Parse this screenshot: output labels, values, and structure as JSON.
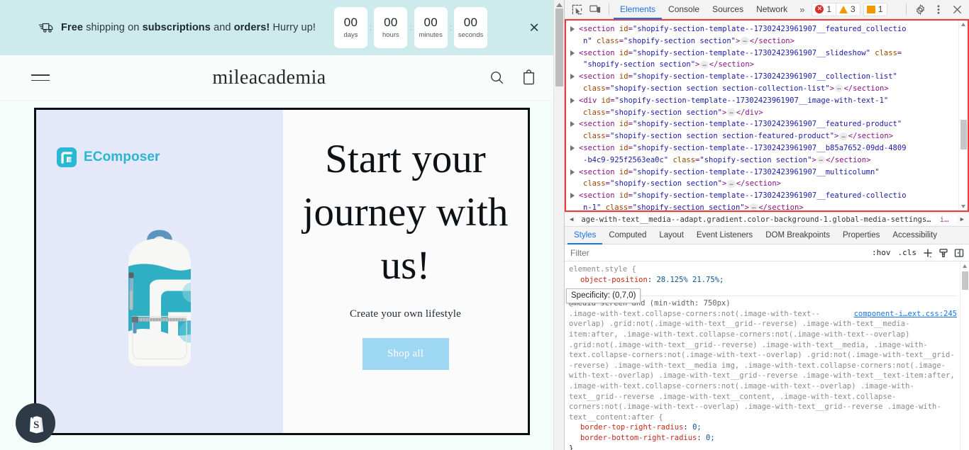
{
  "site": {
    "announcement": {
      "icon": "shipping-truck-icon",
      "text_parts": [
        {
          "t": "Free",
          "bold": true
        },
        {
          "t": " shipping on ",
          "bold": false
        },
        {
          "t": "subscriptions",
          "bold": true
        },
        {
          "t": " and ",
          "bold": false
        },
        {
          "t": "orders!",
          "bold": true
        },
        {
          "t": " Hurry up!",
          "bold": false
        }
      ],
      "full_text": "Free shipping on subscriptions and orders! Hurry up!",
      "close_label": "×",
      "countdown": [
        {
          "value": "00",
          "label": "days"
        },
        {
          "value": "00",
          "label": "hours"
        },
        {
          "value": "00",
          "label": "minutes"
        },
        {
          "value": "00",
          "label": "seconds"
        }
      ],
      "separator": ":",
      "bg_color": "#cdeaec"
    },
    "header": {
      "menu_icon": "hamburger-menu-icon",
      "brand": "mileacademia",
      "search_icon": "search-icon",
      "cart_icon": "cart-icon"
    },
    "hero": {
      "badge_text": "EComposer",
      "badge_color": "#29b6d1",
      "title": "Start your journey with us!",
      "subtitle": "Create your own lifestyle",
      "button_label": "Shop all",
      "button_color": "#9ed7f2",
      "media_highlight_color": "#e4e8f9",
      "product_alt": "teal and white backpack"
    },
    "shopify_bubble": "shopify-bag-icon"
  },
  "devtools": {
    "toolbar": {
      "inspect_icon": "inspect-element-icon",
      "device_icon": "device-toolbar-icon",
      "tabs": [
        {
          "label": "Elements",
          "active": true
        },
        {
          "label": "Console",
          "active": false
        },
        {
          "label": "Sources",
          "active": false
        },
        {
          "label": "Network",
          "active": false
        }
      ],
      "more_tabs": "»",
      "error_count": "1",
      "warning_count": "3",
      "issue_count": "1",
      "settings_icon": "gear-icon",
      "kebab_icon": "more-vertical-icon",
      "close_icon": "close-icon"
    },
    "dom_nodes": [
      {
        "lines": [
          [
            {
              "c": "punc",
              "t": "<"
            },
            {
              "c": "tag",
              "t": "section"
            },
            {
              "c": "sp",
              "t": " "
            },
            {
              "c": "attr",
              "t": "id"
            },
            {
              "c": "punc",
              "t": "="
            },
            {
              "c": "val",
              "t": "\"shopify-section-template--17302423961907__featured_collectio"
            }
          ],
          [
            {
              "c": "val",
              "t": "n\""
            },
            {
              "c": "sp",
              "t": " "
            },
            {
              "c": "attr",
              "t": "class"
            },
            {
              "c": "punc",
              "t": "="
            },
            {
              "c": "val",
              "t": "\"shopify-section section\""
            },
            {
              "c": "punc",
              "t": ">"
            },
            {
              "c": "dots",
              "t": "…"
            },
            {
              "c": "punc",
              "t": "</"
            },
            {
              "c": "tag",
              "t": "section"
            },
            {
              "c": "punc",
              "t": ">"
            }
          ]
        ]
      },
      {
        "lines": [
          [
            {
              "c": "punc",
              "t": "<"
            },
            {
              "c": "tag",
              "t": "section"
            },
            {
              "c": "sp",
              "t": " "
            },
            {
              "c": "attr",
              "t": "id"
            },
            {
              "c": "punc",
              "t": "="
            },
            {
              "c": "val",
              "t": "\"shopify-section-template--17302423961907__slideshow\""
            },
            {
              "c": "sp",
              "t": " "
            },
            {
              "c": "attr",
              "t": "class"
            },
            {
              "c": "punc",
              "t": "="
            }
          ],
          [
            {
              "c": "val",
              "t": "\"shopify-section section\""
            },
            {
              "c": "punc",
              "t": ">"
            },
            {
              "c": "dots",
              "t": "…"
            },
            {
              "c": "punc",
              "t": "</"
            },
            {
              "c": "tag",
              "t": "section"
            },
            {
              "c": "punc",
              "t": ">"
            }
          ]
        ]
      },
      {
        "lines": [
          [
            {
              "c": "punc",
              "t": "<"
            },
            {
              "c": "tag",
              "t": "section"
            },
            {
              "c": "sp",
              "t": " "
            },
            {
              "c": "attr",
              "t": "id"
            },
            {
              "c": "punc",
              "t": "="
            },
            {
              "c": "val",
              "t": "\"shopify-section-template--17302423961907__collection-list\""
            }
          ],
          [
            {
              "c": "attr",
              "t": "class"
            },
            {
              "c": "punc",
              "t": "="
            },
            {
              "c": "val",
              "t": "\"shopify-section section section-collection-list\""
            },
            {
              "c": "punc",
              "t": ">"
            },
            {
              "c": "dots",
              "t": "…"
            },
            {
              "c": "punc",
              "t": "</"
            },
            {
              "c": "tag",
              "t": "section"
            },
            {
              "c": "punc",
              "t": ">"
            }
          ]
        ]
      },
      {
        "lines": [
          [
            {
              "c": "punc",
              "t": "<"
            },
            {
              "c": "tag",
              "t": "div"
            },
            {
              "c": "sp",
              "t": " "
            },
            {
              "c": "attr",
              "t": "id"
            },
            {
              "c": "punc",
              "t": "="
            },
            {
              "c": "val",
              "t": "\"shopify-section-template--17302423961907__image-with-text-1\""
            }
          ],
          [
            {
              "c": "attr",
              "t": "class"
            },
            {
              "c": "punc",
              "t": "="
            },
            {
              "c": "val",
              "t": "\"shopify-section section\""
            },
            {
              "c": "punc",
              "t": ">"
            },
            {
              "c": "dots",
              "t": "…"
            },
            {
              "c": "punc",
              "t": "</"
            },
            {
              "c": "tag",
              "t": "div"
            },
            {
              "c": "punc",
              "t": ">"
            }
          ]
        ]
      },
      {
        "lines": [
          [
            {
              "c": "punc",
              "t": "<"
            },
            {
              "c": "tag",
              "t": "section"
            },
            {
              "c": "sp",
              "t": " "
            },
            {
              "c": "attr",
              "t": "id"
            },
            {
              "c": "punc",
              "t": "="
            },
            {
              "c": "val",
              "t": "\"shopify-section-template--17302423961907__featured-product\""
            }
          ],
          [
            {
              "c": "attr",
              "t": "class"
            },
            {
              "c": "punc",
              "t": "="
            },
            {
              "c": "val",
              "t": "\"shopify-section section section-featured-product\""
            },
            {
              "c": "punc",
              "t": ">"
            },
            {
              "c": "dots",
              "t": "…"
            },
            {
              "c": "punc",
              "t": "</"
            },
            {
              "c": "tag",
              "t": "section"
            },
            {
              "c": "punc",
              "t": ">"
            }
          ]
        ]
      },
      {
        "lines": [
          [
            {
              "c": "punc",
              "t": "<"
            },
            {
              "c": "tag",
              "t": "section"
            },
            {
              "c": "sp",
              "t": " "
            },
            {
              "c": "attr",
              "t": "id"
            },
            {
              "c": "punc",
              "t": "="
            },
            {
              "c": "val",
              "t": "\"shopify-section-template--17302423961907__b85a7652-09dd-4809"
            }
          ],
          [
            {
              "c": "val",
              "t": "-b4c9-925f2563ea0c\""
            },
            {
              "c": "sp",
              "t": " "
            },
            {
              "c": "attr",
              "t": "class"
            },
            {
              "c": "punc",
              "t": "="
            },
            {
              "c": "val",
              "t": "\"shopify-section section\""
            },
            {
              "c": "punc",
              "t": ">"
            },
            {
              "c": "dots",
              "t": "…"
            },
            {
              "c": "punc",
              "t": "</"
            },
            {
              "c": "tag",
              "t": "section"
            },
            {
              "c": "punc",
              "t": ">"
            }
          ]
        ]
      },
      {
        "lines": [
          [
            {
              "c": "punc",
              "t": "<"
            },
            {
              "c": "tag",
              "t": "section"
            },
            {
              "c": "sp",
              "t": " "
            },
            {
              "c": "attr",
              "t": "id"
            },
            {
              "c": "punc",
              "t": "="
            },
            {
              "c": "val",
              "t": "\"shopify-section-template--17302423961907__multicolumn\""
            }
          ],
          [
            {
              "c": "attr",
              "t": "class"
            },
            {
              "c": "punc",
              "t": "="
            },
            {
              "c": "val",
              "t": "\"shopify-section section\""
            },
            {
              "c": "punc",
              "t": ">"
            },
            {
              "c": "dots",
              "t": "…"
            },
            {
              "c": "punc",
              "t": "</"
            },
            {
              "c": "tag",
              "t": "section"
            },
            {
              "c": "punc",
              "t": ">"
            }
          ]
        ]
      },
      {
        "lines": [
          [
            {
              "c": "punc",
              "t": "<"
            },
            {
              "c": "tag",
              "t": "section"
            },
            {
              "c": "sp",
              "t": " "
            },
            {
              "c": "attr",
              "t": "id"
            },
            {
              "c": "punc",
              "t": "="
            },
            {
              "c": "val",
              "t": "\"shopify-section-template--17302423961907__featured-collectio"
            }
          ],
          [
            {
              "c": "val",
              "t": "n-1\""
            },
            {
              "c": "sp",
              "t": " "
            },
            {
              "c": "attr",
              "t": "class"
            },
            {
              "c": "punc",
              "t": "="
            },
            {
              "c": "val",
              "t": "\"shopify-section section\""
            },
            {
              "c": "punc",
              "t": ">"
            },
            {
              "c": "dots",
              "t": "…"
            },
            {
              "c": "punc",
              "t": "</"
            },
            {
              "c": "tag",
              "t": "section"
            },
            {
              "c": "punc",
              "t": ">"
            }
          ]
        ]
      }
    ],
    "breadcrumb": {
      "back_arrow": "◀",
      "crumb": "age-with-text__media--adapt.gradient.color-background-1.global-media-settings.media",
      "selected": "img",
      "forward_arrow": "▶"
    },
    "styles_tabs": [
      {
        "label": "Styles",
        "active": true
      },
      {
        "label": "Computed",
        "active": false
      },
      {
        "label": "Layout",
        "active": false
      },
      {
        "label": "Event Listeners",
        "active": false
      },
      {
        "label": "DOM Breakpoints",
        "active": false
      },
      {
        "label": "Properties",
        "active": false
      },
      {
        "label": "Accessibility",
        "active": false
      }
    ],
    "filter": {
      "placeholder": "Filter",
      "value": "",
      "hov_label": ":hov",
      "cls_label": ".cls",
      "new_rule_icon": "plus-icon",
      "style_element_icon": "paintbrush-icon",
      "toggle_sidebar_icon": "toggle-panel-icon"
    },
    "css": {
      "element_style_header": "element.style {",
      "element_style_props": [
        {
          "name": "object-position",
          "value": "28.125% 21.75%;"
        }
      ],
      "element_style_close": "}",
      "tooltip": "Specificity: (0,7,0)",
      "media_query": "@media screen and (min-width: 750px)",
      "source_link": "component-i…ext.css:245",
      "selector_text": ".image-with-text.collapse-corners:not(.image-with-text--overlap) .grid:not(.image-with-text__grid--reverse) .image-with-text__media-item:after, .image-with-text.collapse-corners:not(.image-with-text--overlap) .grid:not(.image-with-text__grid--reverse) .image-with-text__media, .image-with-text.collapse-corners:not(.image-with-text--overlap) .grid:not(.image-with-text__grid--reverse) .image-with-text__media img, .image-with-text.collapse-corners:not(.image-with-text--overlap) .image-with-text__grid--reverse .image-with-text__text-item:after, .image-with-text.collapse-corners:not(.image-with-text--overlap) .image-with-text__grid--reverse .image-with-text__content, .image-with-text.collapse-corners:not(.image-with-text--overlap) .image-with-text__grid--reverse .image-with-text__content:after {",
      "rule_props": [
        {
          "name": "border-top-right-radius",
          "value": "0;"
        },
        {
          "name": "border-bottom-right-radius",
          "value": "0;"
        }
      ]
    }
  }
}
